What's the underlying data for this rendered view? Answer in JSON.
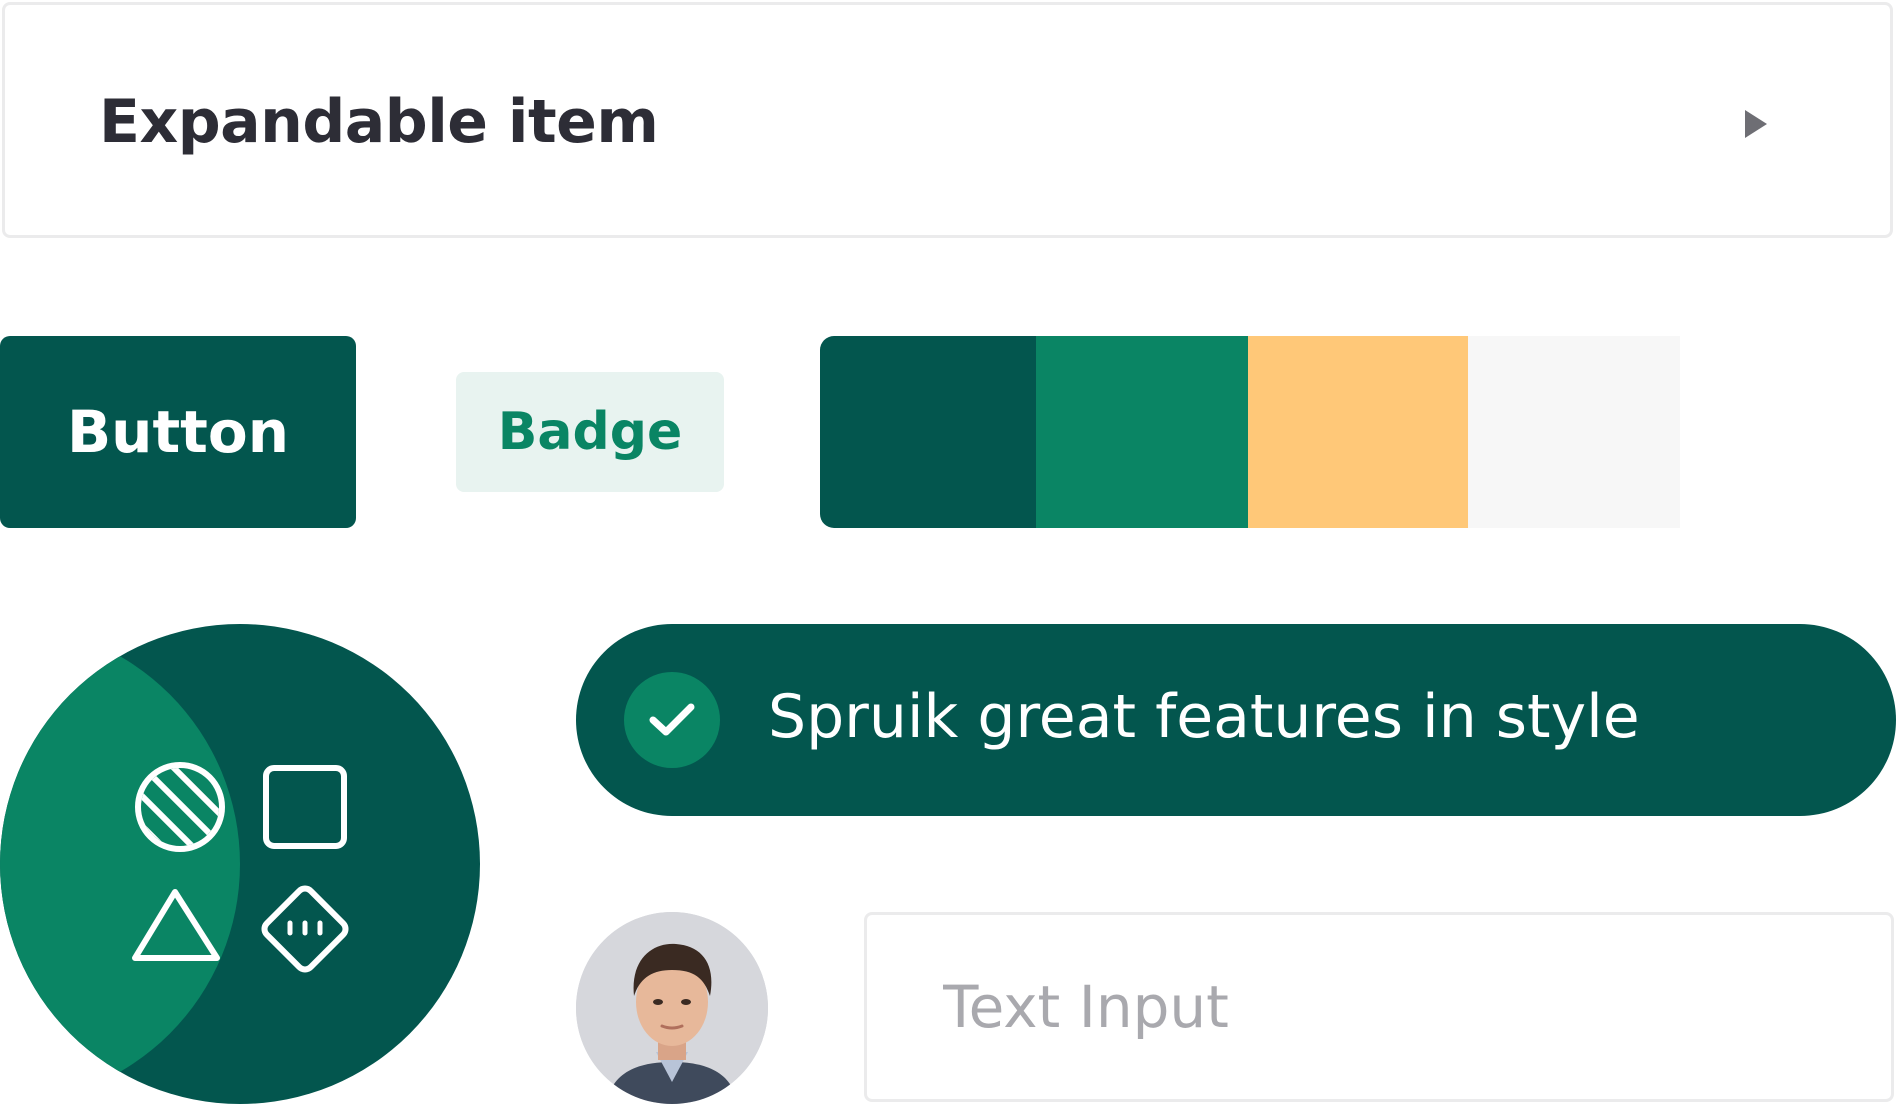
{
  "expandable": {
    "label": "Expandable item",
    "icon": "caret-right-icon"
  },
  "button": {
    "label": "Button"
  },
  "badge": {
    "label": "Badge"
  },
  "palette": {
    "colors": [
      "#03564e",
      "#0a8564",
      "#ffc878",
      "#f7f7f7",
      "#ffffff"
    ]
  },
  "shapes": {
    "icons": [
      "striped-circle-icon",
      "square-icon",
      "triangle-icon",
      "dotted-diamond-icon"
    ],
    "colors": {
      "dark": "#03564e",
      "light": "#0a8564"
    }
  },
  "feature": {
    "text": "Spruik great features in style",
    "icon": "check-icon"
  },
  "avatar": {
    "icon": "user-photo"
  },
  "input": {
    "placeholder": "Text Input"
  },
  "theme": {
    "primary": "#03564e",
    "accent": "#0a8564",
    "warm": "#ffc878",
    "text": "#2d2d36"
  }
}
